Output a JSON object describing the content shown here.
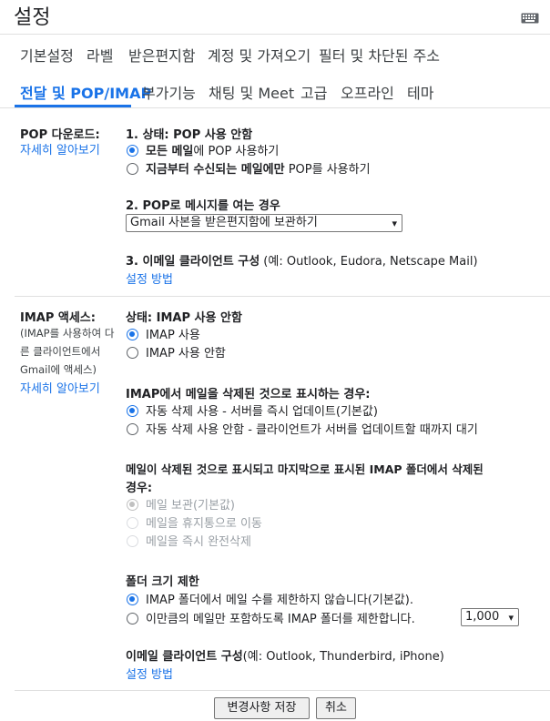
{
  "header": {
    "title": "설정",
    "keyboard_icon": "keyboard-icon"
  },
  "tabs_row1": [
    "기본설정",
    "라벨",
    "받은편지함",
    "계정 및 가져오기",
    "필터 및 차단된 주소"
  ],
  "tabs_row2": [
    "전달 및 POP/IMAP",
    "부가기능",
    "채팅 및 Meet",
    "고급",
    "오프라인",
    "테마"
  ],
  "pop": {
    "title": "POP 다운로드:",
    "learn_more": "자세히 알아보기",
    "status_heading": "1. 상태: POP 사용 안함",
    "opt_all_bold": "모든 메일",
    "opt_all_rest": "에 POP 사용하기",
    "opt_from_now_bold": "지금부터 수신되는 메일에만",
    "opt_from_now_rest": " POP를 사용하기",
    "when_heading": "2. POP로 메시지를 여는 경우",
    "when_select": "Gmail 사본을 받은편지함에 보관하기",
    "client_heading": "3. 이메일 클라이언트 구성",
    "client_examples": " (예: Outlook, Eudora, Netscape Mail)",
    "setup_link": "설정 방법"
  },
  "imap": {
    "title": "IMAP 액세스:",
    "desc_line1": "(IMAP를 사용하여 다",
    "desc_line2": "른 클라이언트에서",
    "desc_line3": "Gmail에 액세스)",
    "learn_more": "자세히 알아보기",
    "status_heading": "상태: IMAP 사용 안함",
    "opt_enable": "IMAP 사용",
    "opt_disable": "IMAP 사용 안함",
    "delete_heading": "IMAP에서 메일을 삭제된 것으로 표시하는 경우:",
    "opt_auto_expunge_on": "자동 삭제 사용 - 서버를 즉시 업데이트(기본값)",
    "opt_auto_expunge_off": "자동 삭제 사용 안함 - 클라이언트가 서버를 업데이트할 때까지 대기",
    "expunge_heading_line1": "메일이 삭제된 것으로 표시되고 마지막으로 표시된 IMAP 폴더에서 삭제된",
    "expunge_heading_line2": "경우:",
    "opt_archive": "메일 보관(기본값)",
    "opt_trash": "메일을 휴지통으로 이동",
    "opt_delete_forever": "메일을 즉시 완전삭제",
    "folder_heading": "폴더 크기 제한",
    "opt_no_limit": "IMAP 폴더에서 메일 수를 제한하지 않습니다(기본값).",
    "opt_limit": "이만큼의 메일만 포함하도록 IMAP 폴더를 제한합니다.",
    "limit_select": "1,000",
    "client_heading": "이메일 클라이언트 구성",
    "client_examples": "(예: Outlook, Thunderbird, iPhone)",
    "setup_link": "설정 방법"
  },
  "footer": {
    "save": "변경사항 저장",
    "cancel": "취소"
  },
  "colors": {
    "accent": "#1a73e8",
    "text": "#202124",
    "divider": "#e0e0e0"
  }
}
